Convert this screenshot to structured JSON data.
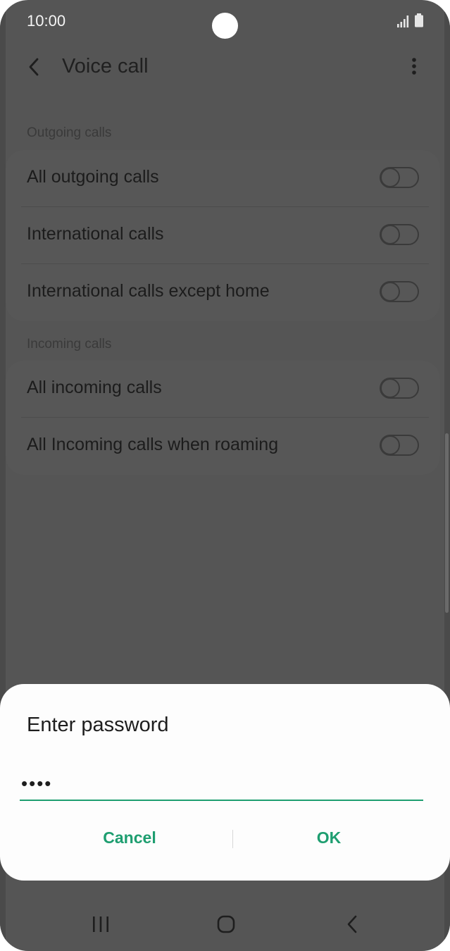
{
  "status_bar": {
    "time": "10:00",
    "icons": [
      "signal-icon",
      "battery-icon"
    ]
  },
  "app_bar": {
    "title": "Voice call",
    "back_icon": "chevron-left-icon",
    "menu_icon": "more-vertical-icon"
  },
  "sections": [
    {
      "header": "Outgoing calls",
      "items": [
        {
          "label": "All outgoing calls",
          "enabled": false
        },
        {
          "label": "International calls",
          "enabled": false
        },
        {
          "label": "International calls except home",
          "enabled": false
        }
      ]
    },
    {
      "header": "Incoming calls",
      "items": [
        {
          "label": "All incoming calls",
          "enabled": false
        },
        {
          "label": "All Incoming calls when roaming",
          "enabled": false
        }
      ]
    }
  ],
  "dialog": {
    "title": "Enter password",
    "password_value": "••••",
    "cancel_label": "Cancel",
    "ok_label": "OK"
  },
  "nav_bar": {
    "icons": [
      "recent-apps-icon",
      "home-icon",
      "back-icon"
    ]
  },
  "colors": {
    "accent": "#1e9e70",
    "dimmed_background": "#555555",
    "dialog_background": "#fdfdfd"
  }
}
